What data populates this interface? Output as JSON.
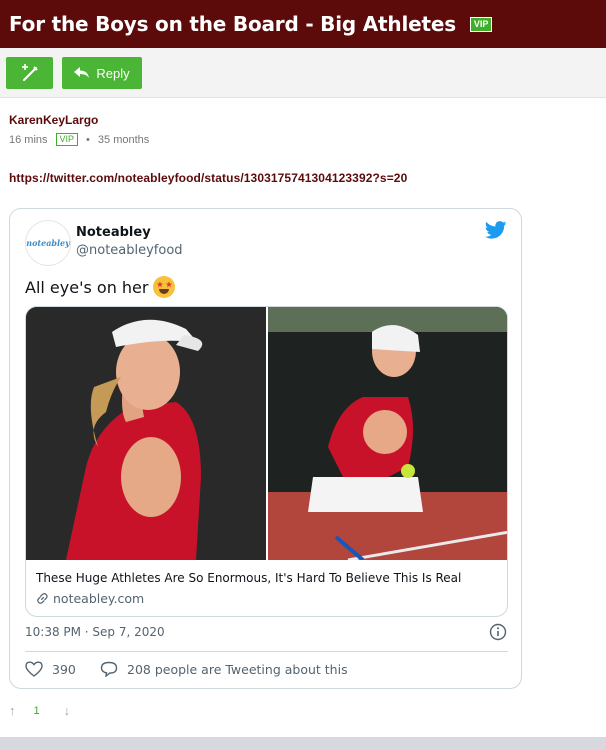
{
  "thread": {
    "title": "For the Boys on the Board - Big Athletes",
    "vip_label": "VIP"
  },
  "toolbar": {
    "reply_label": "Reply",
    "edit_icon": "magic-wand-edit-icon",
    "reply_icon": "reply-arrow-icon"
  },
  "post": {
    "author": "KarenKeyLargo",
    "time": "16 mins",
    "vip_label": "VIP",
    "separator": "•",
    "account_age": "35 months",
    "link": "https://twitter.com/noteableyfood/status/1303175741304123392?s=20",
    "votes": {
      "up_icon": "arrow-up-icon",
      "count": "1",
      "down_icon": "arrow-down-icon"
    }
  },
  "tweet": {
    "avatar_text": "noteabley",
    "name": "Noteabley",
    "handle": "@noteableyfood",
    "text": "All eye's on her",
    "emoji": "star-struck-emoji",
    "card": {
      "title": "These Huge Athletes Are So Enormous, It's Hard To Believe This Is Real",
      "domain": "noteabley.com"
    },
    "timestamp": "10:38 PM · Sep 7, 2020",
    "likes": "390",
    "replies_text": "208 people are Tweeting about this"
  },
  "colors": {
    "brand": "#5c0a0a",
    "accent": "#4bb535",
    "twitter": "#1d9bf0"
  }
}
